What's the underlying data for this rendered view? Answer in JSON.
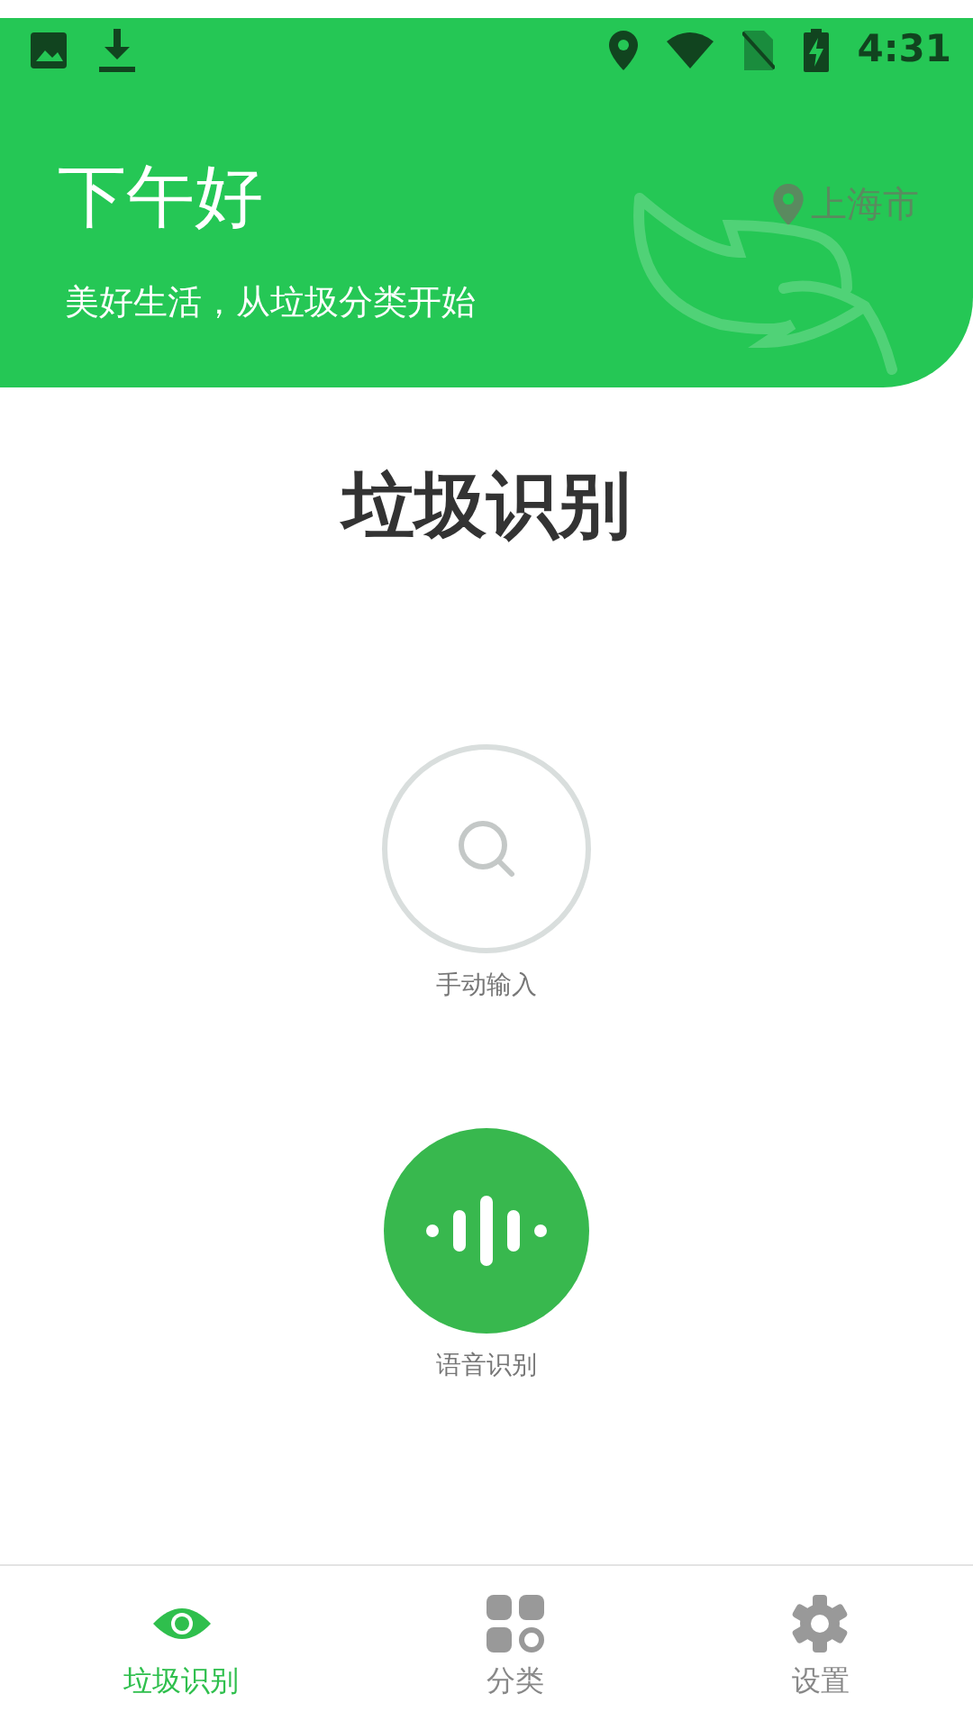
{
  "status_bar": {
    "time": "4:31"
  },
  "header": {
    "greeting": "下午好",
    "subtitle": "美好生活，从垃圾分类开始",
    "location": "上海市"
  },
  "title": "垃圾识别",
  "actions": [
    {
      "kind": "manual",
      "label": "手动输入"
    },
    {
      "kind": "voice",
      "label": "语音识别"
    }
  ],
  "nav": [
    {
      "kind": "eye",
      "label": "垃圾识别",
      "selected": true
    },
    {
      "kind": "grid",
      "label": "分类",
      "selected": false
    },
    {
      "kind": "gear",
      "label": "设置",
      "selected": false
    }
  ]
}
